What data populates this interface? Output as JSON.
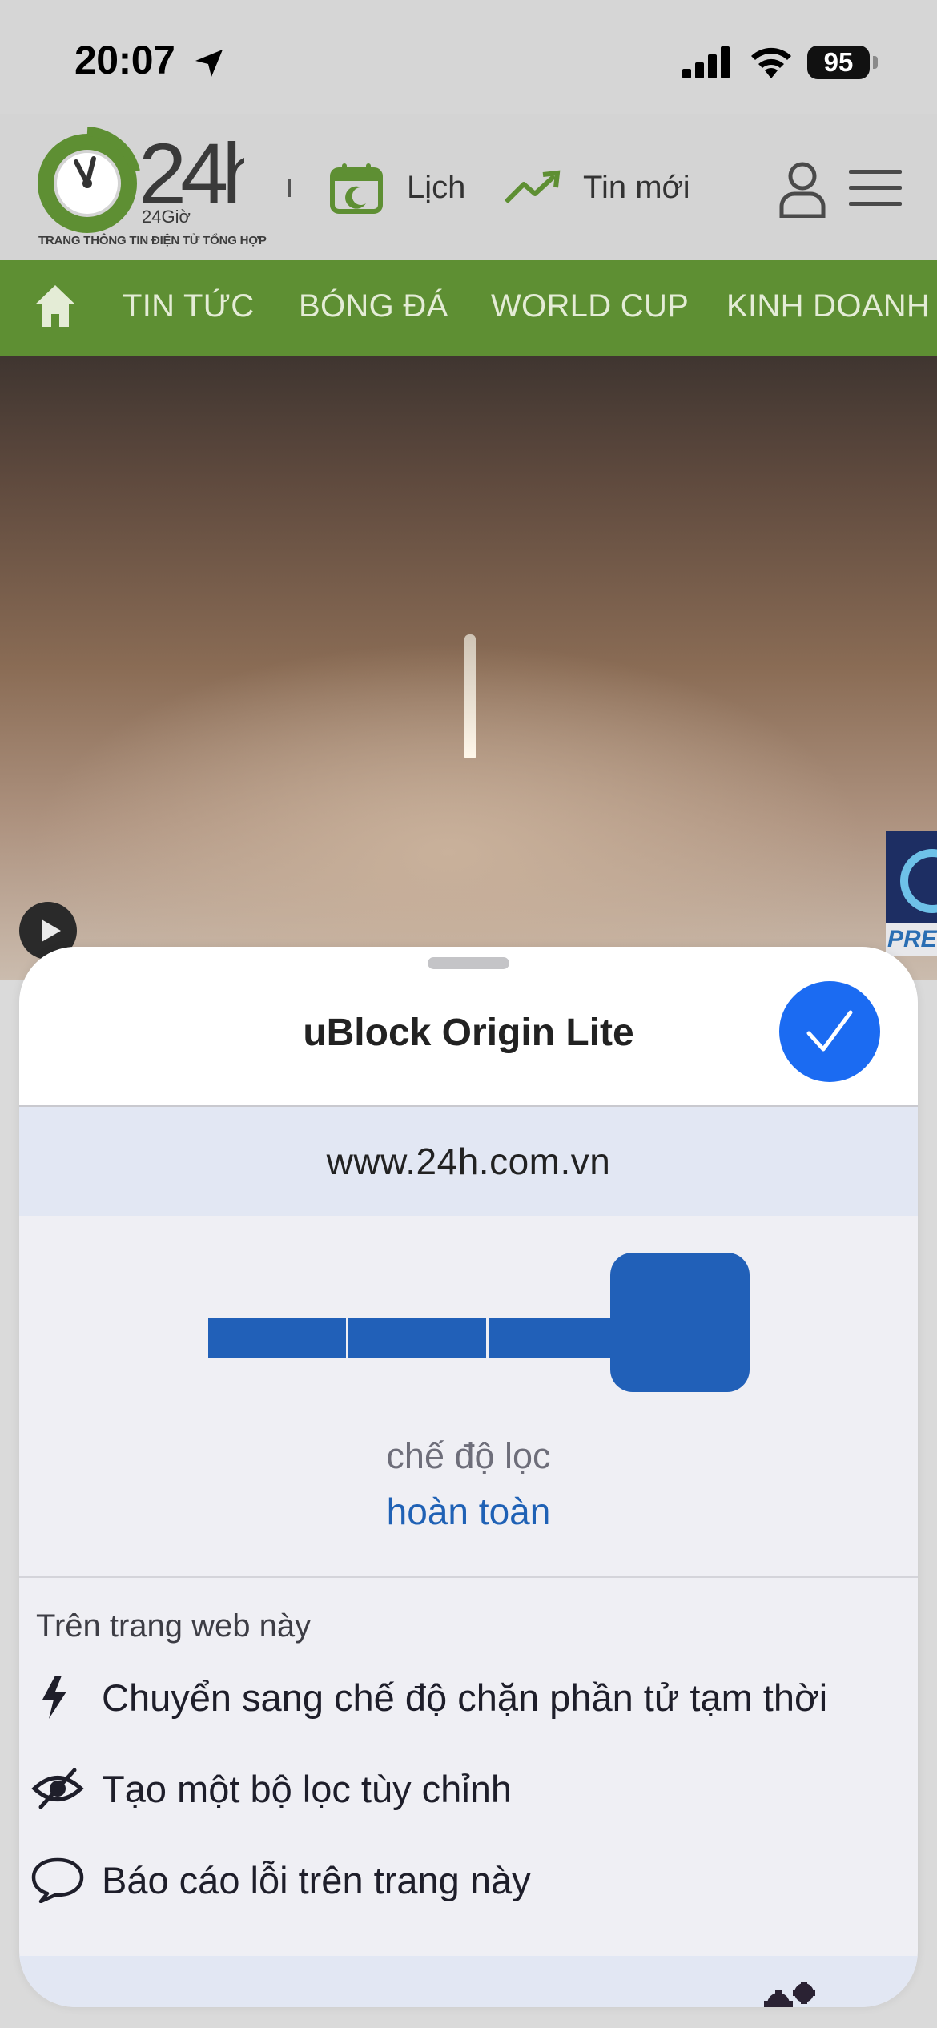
{
  "status_bar": {
    "time": "20:07",
    "battery": "95",
    "icons": [
      "location-arrow-icon",
      "signal-icon",
      "wifi-icon",
      "battery-icon"
    ]
  },
  "site_header": {
    "logo_text": "24h",
    "logo_subtext": "24Giờ",
    "tagline": "TRANG THÔNG TIN ĐIỆN TỬ TỔNG HỢP",
    "calendar_label": "Lịch",
    "latest_label": "Tin mới",
    "brand_color": "#5e8f33"
  },
  "nav": {
    "items": [
      "TIN TỨC",
      "BÓNG ĐÁ",
      "WORLD CUP",
      "KINH DOANH"
    ]
  },
  "video": {
    "badge_text": "PRES"
  },
  "sheet": {
    "title": "uBlock Origin Lite",
    "hostname": "www.24h.com.vn",
    "filter_level": 4,
    "filter_level_max": 4,
    "filter_mode_caption": "chế độ lọc",
    "filter_mode_value": "hoàn toàn",
    "section_heading": "Trên trang web này",
    "actions": [
      {
        "icon": "lightning-icon",
        "label": "Chuyển sang chế độ chặn phần tử tạm thời"
      },
      {
        "icon": "eye-slash-icon",
        "label": "Tạo một bộ lọc tùy chỉnh"
      },
      {
        "icon": "speech-bubble-icon",
        "label": "Báo cáo lỗi trên trang này"
      }
    ],
    "accent_color": "#2160b8",
    "done_color": "#1b6bf2"
  }
}
